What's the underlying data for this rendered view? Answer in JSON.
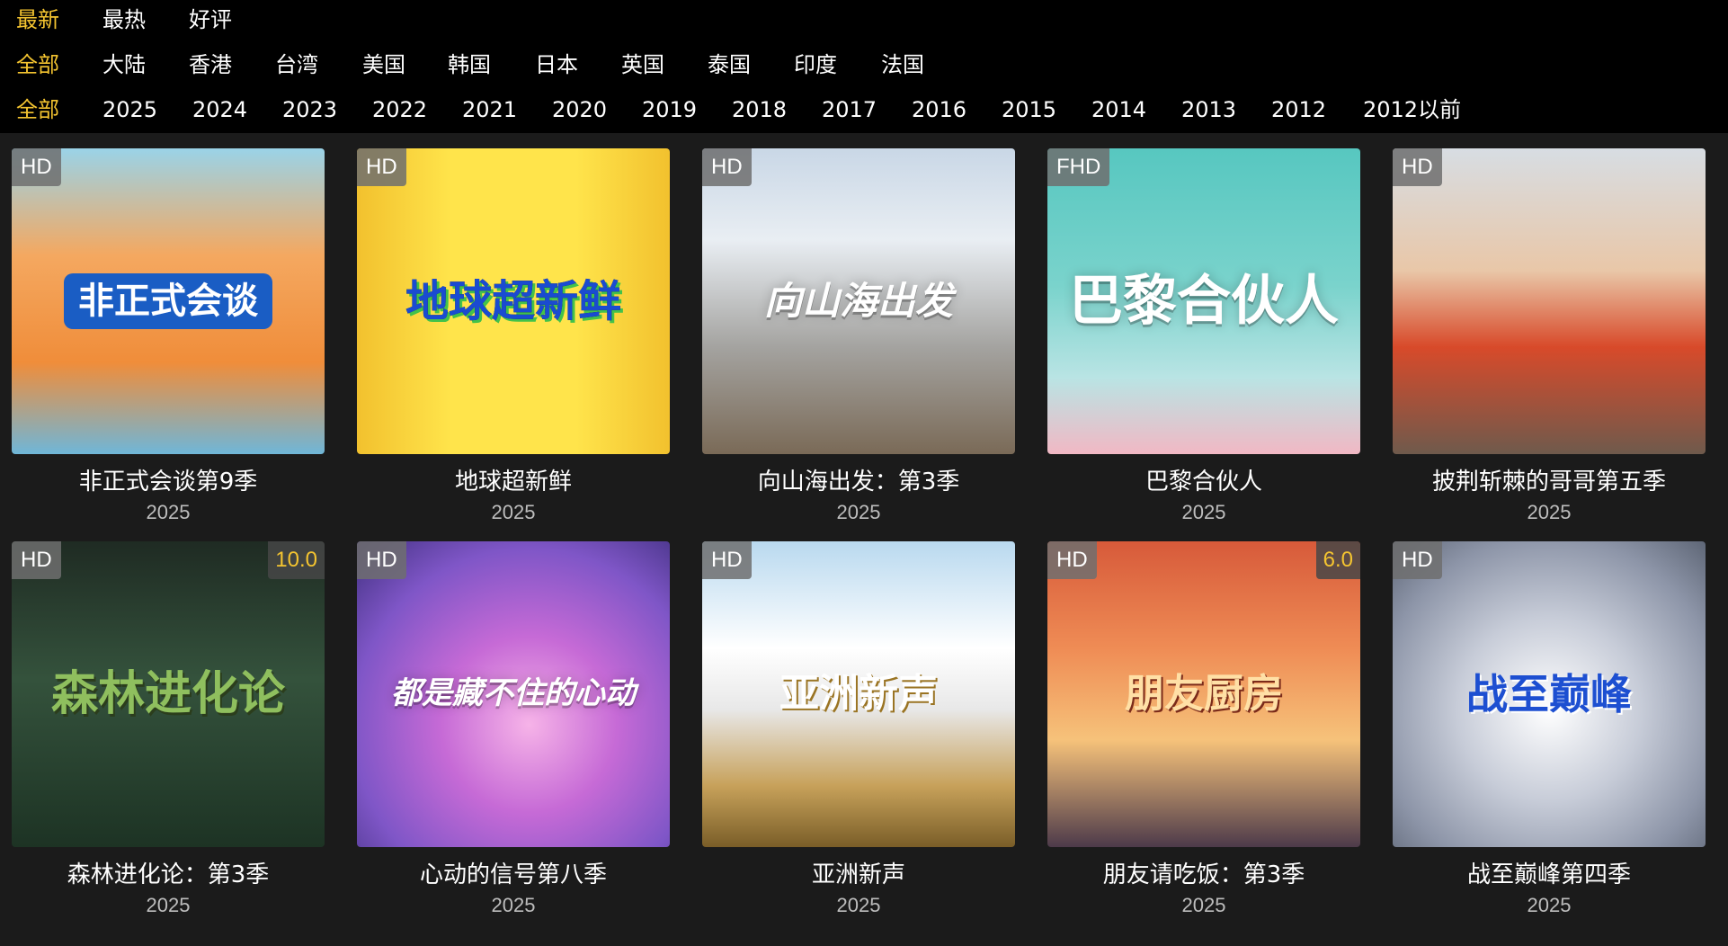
{
  "filters": {
    "sort": {
      "options": [
        "最新",
        "最热",
        "好评"
      ],
      "active_index": 0
    },
    "region": {
      "options": [
        "全部",
        "大陆",
        "香港",
        "台湾",
        "美国",
        "韩国",
        "日本",
        "英国",
        "泰国",
        "印度",
        "法国"
      ],
      "active_index": 0
    },
    "year": {
      "options": [
        "全部",
        "2025",
        "2024",
        "2023",
        "2022",
        "2021",
        "2020",
        "2019",
        "2018",
        "2017",
        "2016",
        "2015",
        "2014",
        "2013",
        "2012",
        "2012以前"
      ],
      "active_index": 0
    }
  },
  "colors": {
    "active": "#f4c430",
    "text": "#ffffff",
    "background": "#1b1b1b",
    "filter_bar": "#000000"
  },
  "cards": [
    {
      "title": "非正式会谈第9季",
      "year": "2025",
      "badge": "HD",
      "score": null,
      "poster_text": "非正式会谈"
    },
    {
      "title": "地球超新鲜",
      "year": "2025",
      "badge": "HD",
      "score": null,
      "poster_text": "地球超新鲜"
    },
    {
      "title": "向山海出发：第3季",
      "year": "2025",
      "badge": "HD",
      "score": null,
      "poster_text": "向山海出发"
    },
    {
      "title": "巴黎合伙人",
      "year": "2025",
      "badge": "FHD",
      "score": null,
      "poster_text": "巴黎合伙人"
    },
    {
      "title": "披荆斩棘的哥哥第五季",
      "year": "2025",
      "badge": "HD",
      "score": null,
      "poster_text": ""
    },
    {
      "title": "森林进化论：第3季",
      "year": "2025",
      "badge": "HD",
      "score": "10.0",
      "poster_text": "森林进化论"
    },
    {
      "title": "心动的信号第八季",
      "year": "2025",
      "badge": "HD",
      "score": null,
      "poster_text": "都是藏不住的心动"
    },
    {
      "title": "亚洲新声",
      "year": "2025",
      "badge": "HD",
      "score": null,
      "poster_text": "亚洲新声"
    },
    {
      "title": "朋友请吃饭：第3季",
      "year": "2025",
      "badge": "HD",
      "score": "6.0",
      "poster_text": "朋友厨房"
    },
    {
      "title": "战至巅峰第四季",
      "year": "2025",
      "badge": "HD",
      "score": null,
      "poster_text": "战至巅峰"
    }
  ]
}
